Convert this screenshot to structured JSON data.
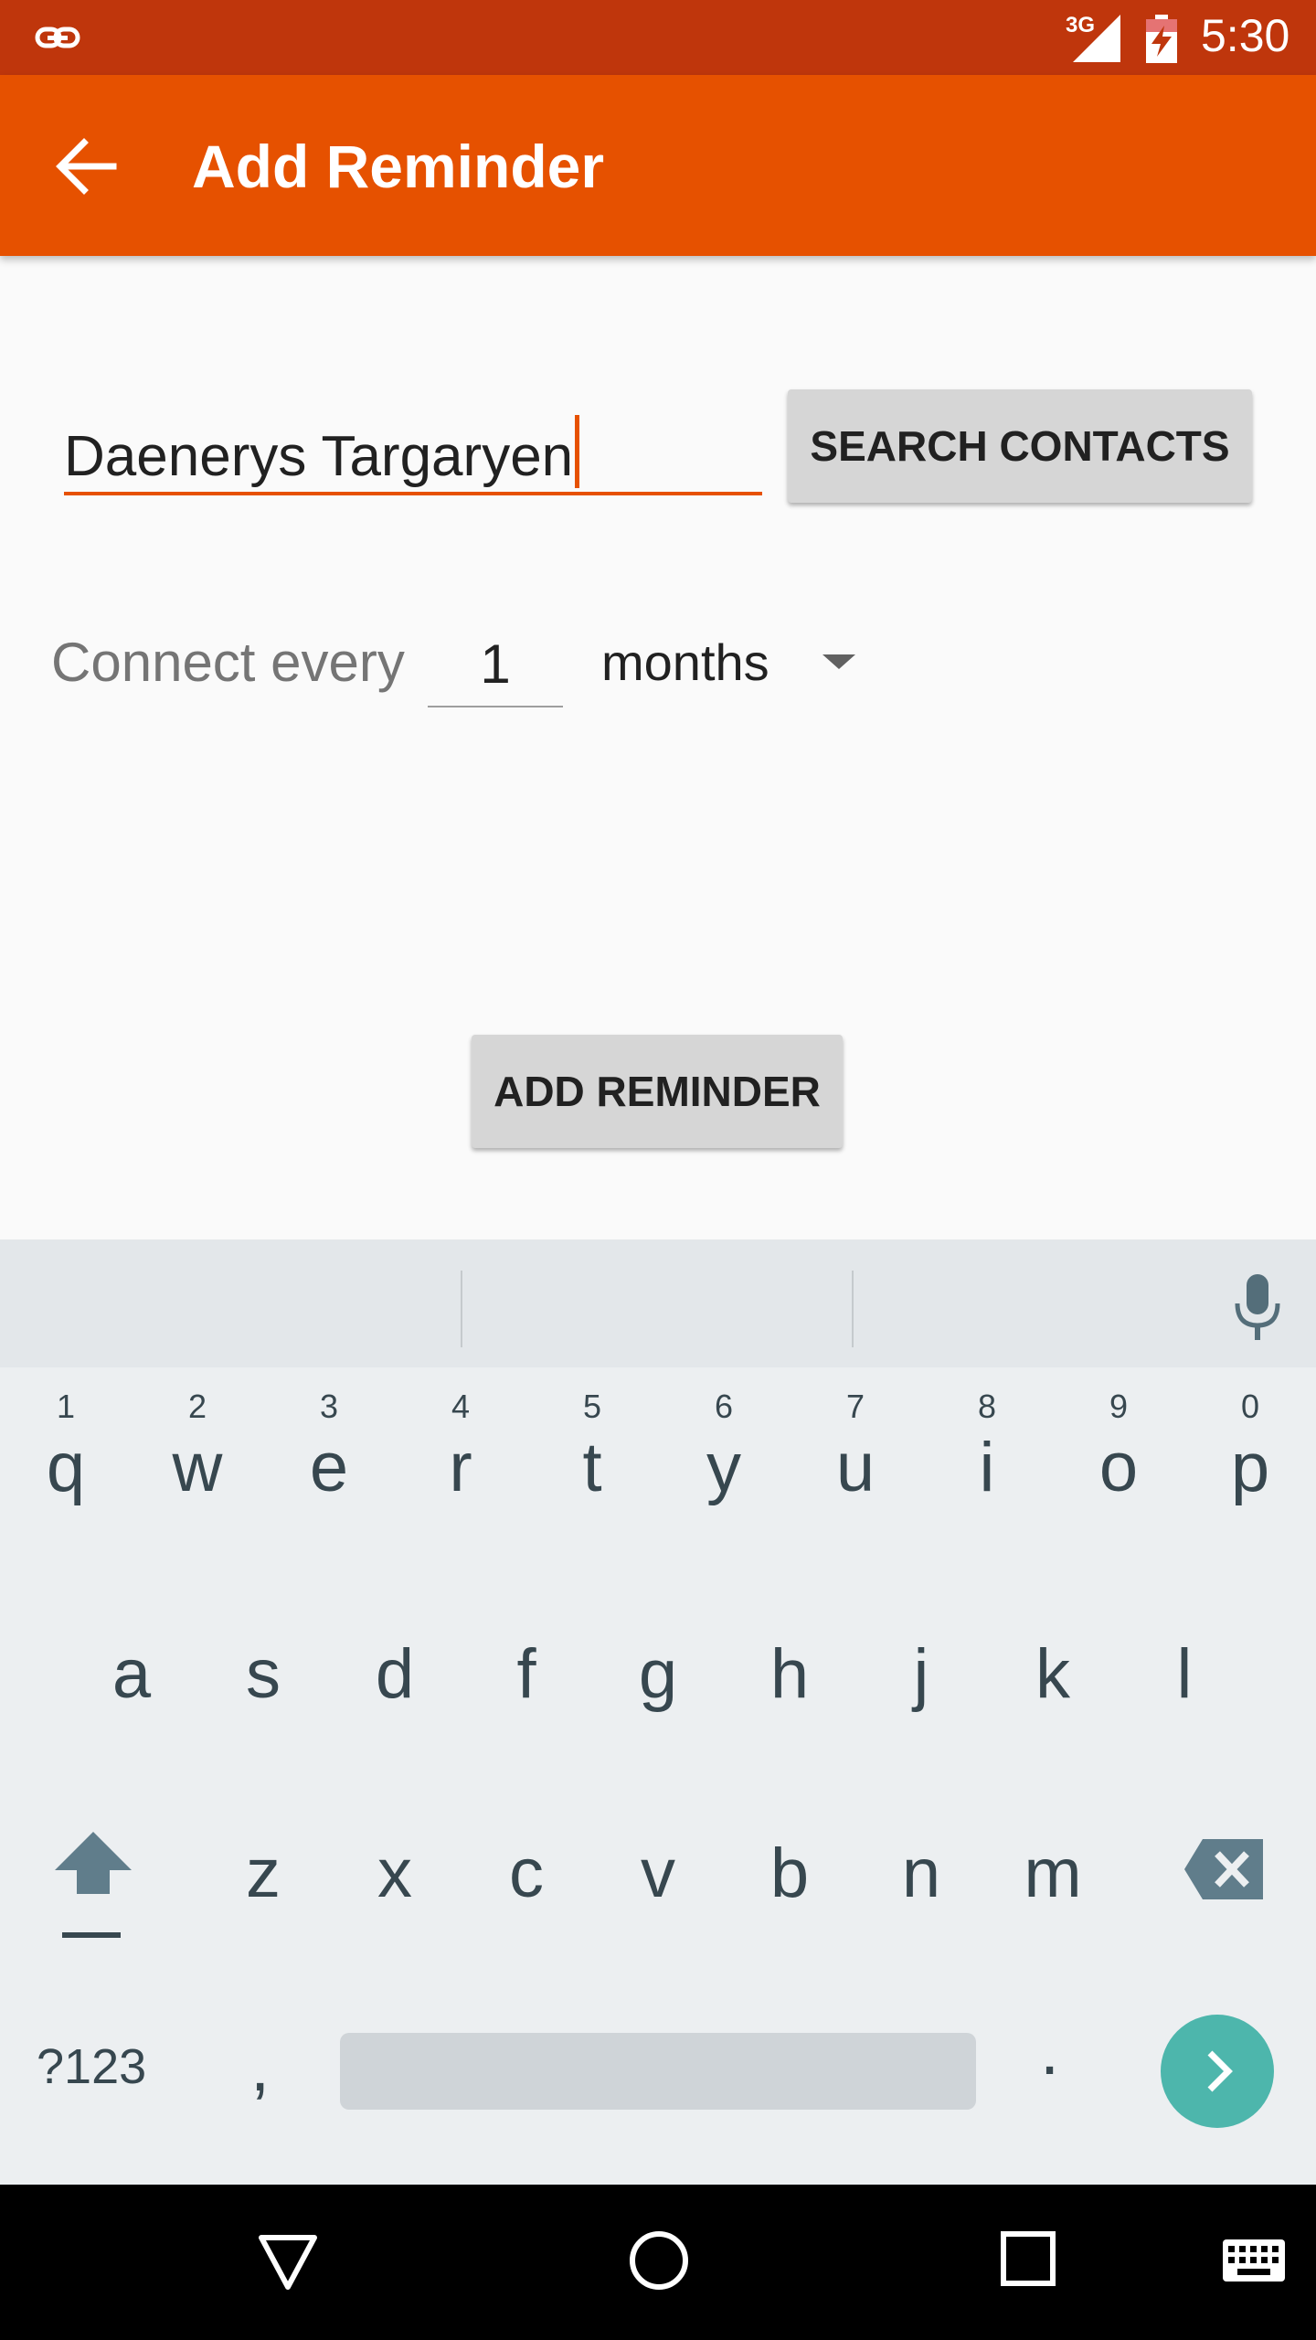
{
  "status_bar": {
    "network": "3G",
    "time": "5:30",
    "icons": [
      "link-icon",
      "signal-icon",
      "battery-charging-icon"
    ]
  },
  "toolbar": {
    "title": "Add Reminder",
    "back_icon": "arrow-left-icon"
  },
  "form": {
    "name_value": "Daenerys Targaryen",
    "search_button": "SEARCH CONTACTS",
    "connect_label": "Connect every",
    "interval_value": "1",
    "interval_unit": "months",
    "add_button": "ADD REMINDER"
  },
  "keyboard": {
    "row1": [
      {
        "key": "q",
        "hint": "1"
      },
      {
        "key": "w",
        "hint": "2"
      },
      {
        "key": "e",
        "hint": "3"
      },
      {
        "key": "r",
        "hint": "4"
      },
      {
        "key": "t",
        "hint": "5"
      },
      {
        "key": "y",
        "hint": "6"
      },
      {
        "key": "u",
        "hint": "7"
      },
      {
        "key": "i",
        "hint": "8"
      },
      {
        "key": "o",
        "hint": "9"
      },
      {
        "key": "p",
        "hint": "0"
      }
    ],
    "row2": [
      "a",
      "s",
      "d",
      "f",
      "g",
      "h",
      "j",
      "k",
      "l"
    ],
    "row3": [
      "z",
      "x",
      "c",
      "v",
      "b",
      "n",
      "m"
    ],
    "symbols_key": "?123",
    "comma_key": ",",
    "period_key": "."
  },
  "colors": {
    "status_bar": "#bf360c",
    "toolbar": "#e65100",
    "accent": "#e65100",
    "go_button": "#4db6ac"
  }
}
